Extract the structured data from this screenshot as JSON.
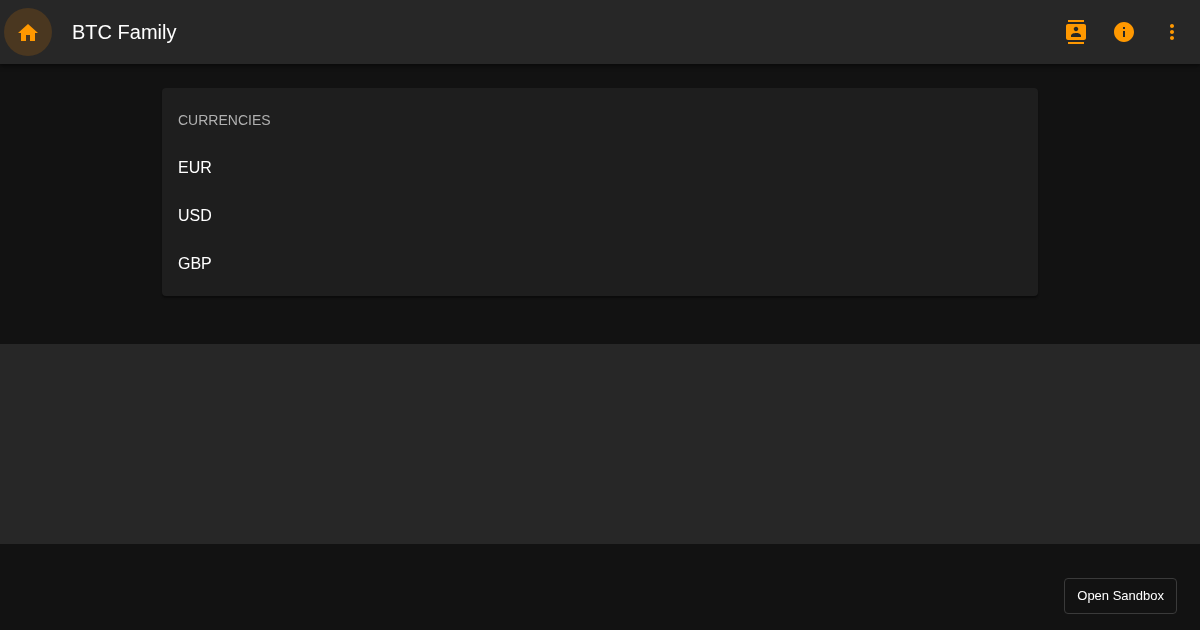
{
  "app_bar": {
    "title": "BTC Family"
  },
  "currencies": {
    "subheader": "CURRENCIES",
    "items": [
      {
        "label": "EUR"
      },
      {
        "label": "USD"
      },
      {
        "label": "GBP"
      }
    ]
  },
  "footer": {
    "button": "Open Sandbox"
  }
}
